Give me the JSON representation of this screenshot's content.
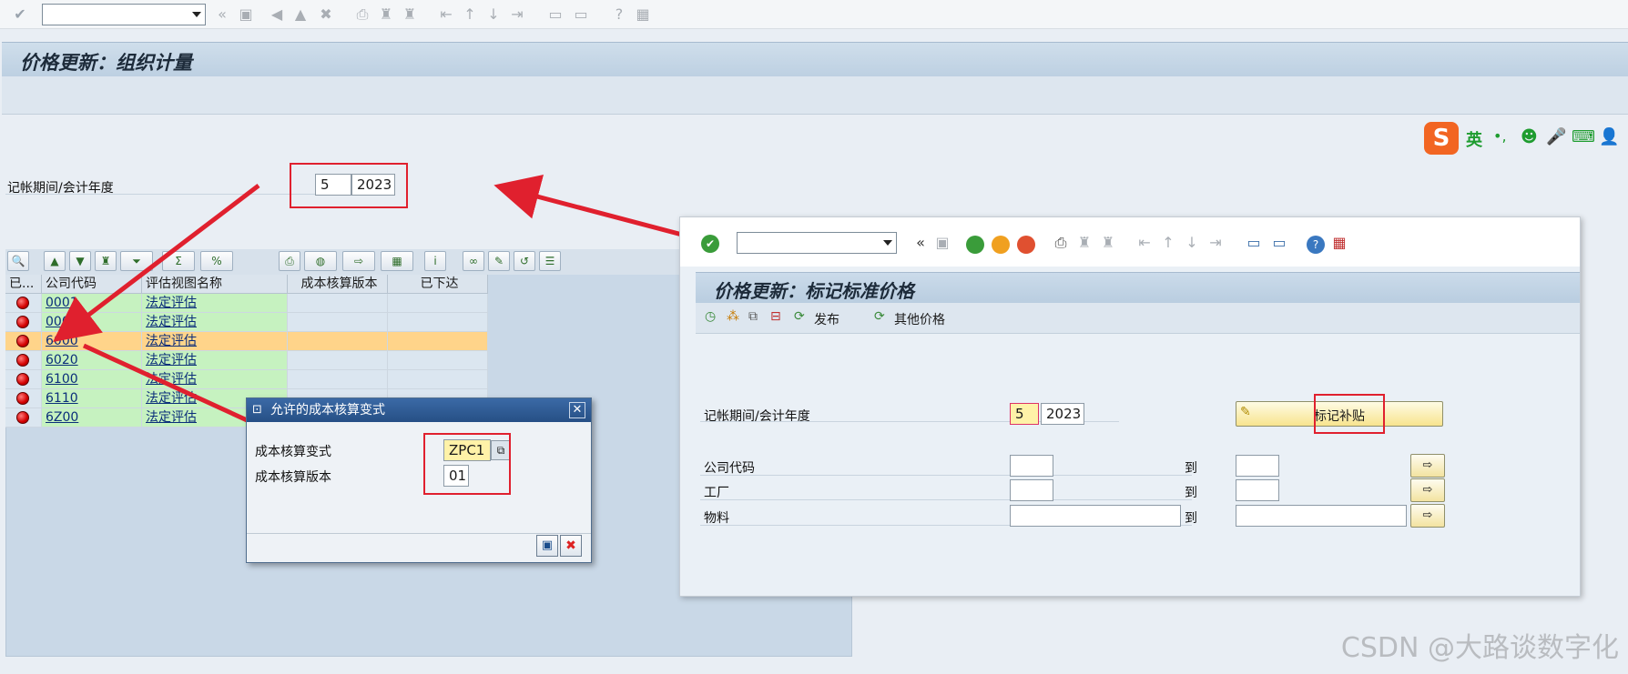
{
  "toolbar": {
    "command_value": ""
  },
  "main": {
    "title": "价格更新：组织计量",
    "period_label": "记帐期间/会计年度",
    "period": "5",
    "year": "2023"
  },
  "grid": {
    "columns": [
      "已...",
      "公司代码",
      "评估视图名称",
      "成本核算版本",
      "已下达"
    ],
    "rows": [
      {
        "code": "0001",
        "view": "法定评估"
      },
      {
        "code": "0001",
        "view": "法定评估"
      },
      {
        "code": "6000",
        "view": "法定评估"
      },
      {
        "code": "6020",
        "view": "法定评估"
      },
      {
        "code": "6100",
        "view": "法定评估"
      },
      {
        "code": "6110",
        "view": "法定评估"
      },
      {
        "code": "6Z00",
        "view": "法定评估"
      }
    ],
    "selected_index": 2
  },
  "dialog": {
    "title": "允许的成本核算变式",
    "variant_label": "成本核算变式",
    "variant_value": "ZPC1",
    "version_label": "成本核算版本",
    "version_value": "01",
    "close_glyph": "✕"
  },
  "panel": {
    "title": "价格更新：标记标准价格",
    "release_label": "发布",
    "other_prices_label": "其他价格",
    "period_label": "记帐期间/会计年度",
    "period": "5",
    "year": "2023",
    "mark_button": "标记补贴",
    "company_label": "公司代码",
    "plant_label": "工厂",
    "material_label": "物料",
    "to_label": "到"
  },
  "ime": {
    "lang": "英"
  },
  "watermark": "CSDN @大路谈数字化",
  "colors": {
    "accent_red": "#e0202e",
    "grid_green": "#c6f2c0",
    "grid_selected": "#ffd48a"
  }
}
